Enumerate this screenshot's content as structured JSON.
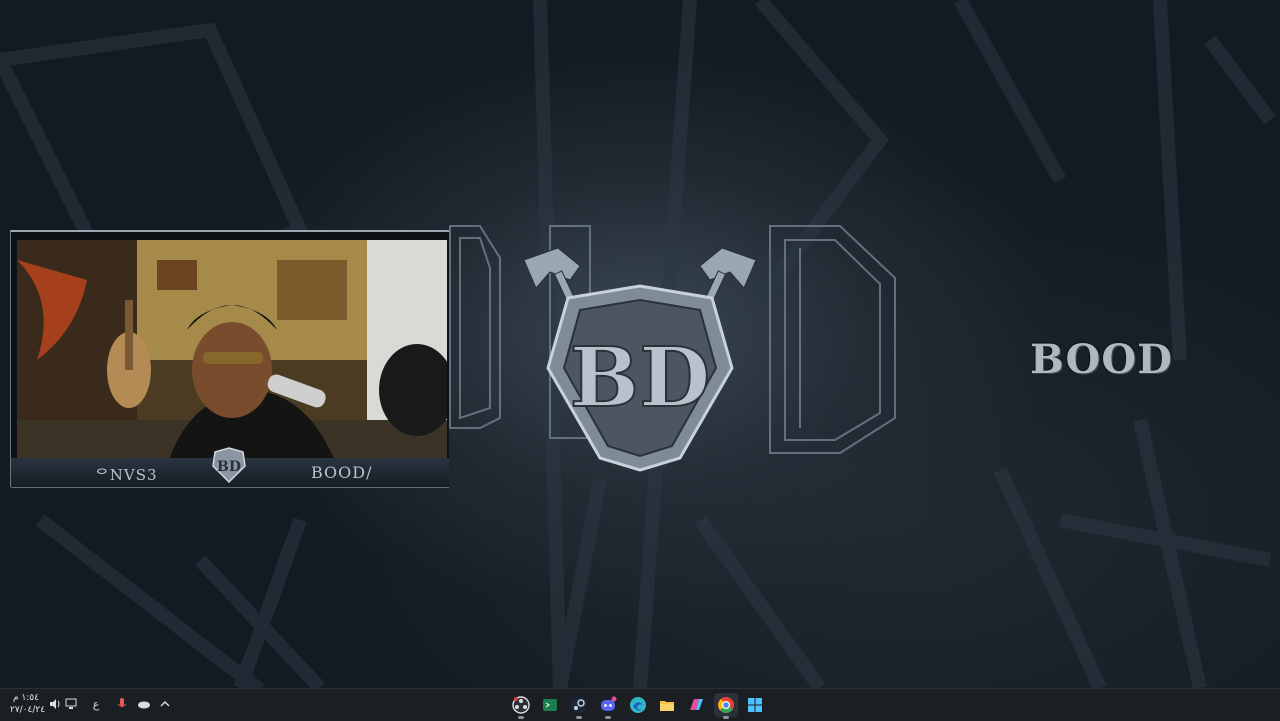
{
  "desktop": {
    "brand_text": "BOOD",
    "wallpaper_colors": {
      "base": "#161d25",
      "glow": "#3a4752",
      "rune": "#2c3844"
    }
  },
  "stream_overlay": {
    "social_handle": "ᄋNVS3",
    "channel_name": "BOOD/",
    "logo_initials": "BD"
  },
  "taskbar": {
    "clock_time": "١:٥٤ م",
    "clock_date": "٢٧/٠٤/٢٤",
    "language_indicator": "ع",
    "tray_icons": [
      "speaker-icon",
      "network-icon",
      "microphone-icon",
      "onedrive-icon",
      "chevron-up-icon"
    ],
    "pinned_apps": [
      {
        "name": "obs-studio-icon",
        "color": "#d9dde1"
      },
      {
        "name": "terminal-icon",
        "color": "#1e7d4f"
      },
      {
        "name": "steam-icon",
        "color": "#c7d5e0"
      },
      {
        "name": "discord-icon",
        "color": "#5865f2"
      },
      {
        "name": "edge-icon",
        "color": "#2fb6c9"
      },
      {
        "name": "file-explorer-icon",
        "color": "#f3c33b"
      },
      {
        "name": "copilot-icon",
        "color": "#e84d9c"
      },
      {
        "name": "chrome-icon",
        "color": "#e94235"
      },
      {
        "name": "start-icon",
        "color": "#4cc2ff"
      }
    ]
  }
}
